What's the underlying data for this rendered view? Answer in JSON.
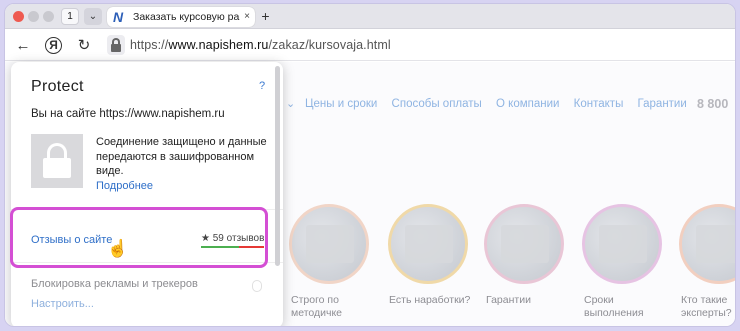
{
  "browser": {
    "tab_count": "1",
    "tab_dropdown_icon": "chevron-down-icon",
    "tab_title": "Заказать курсовую ра",
    "tab_close": "×",
    "new_tab": "+",
    "nav": {
      "back": "←",
      "yandex": "Я",
      "reload": "↻"
    },
    "url_prefix": "https://",
    "url_domain": "www.napishem.ru",
    "url_path": "/zakaz/kursovaja.html"
  },
  "site": {
    "chevron": "⌄",
    "nav_items": [
      "Цены и сроки",
      "Способы оплаты",
      "О компании",
      "Контакты",
      "Гарантии"
    ],
    "phone": "8 800",
    "features": [
      {
        "label": "Строго по методичке"
      },
      {
        "label": "Есть наработки?"
      },
      {
        "label": "Гарантии"
      },
      {
        "label": "Сроки выполнения"
      },
      {
        "label": "Кто такие эксперты?"
      }
    ]
  },
  "protect": {
    "title": "Protect",
    "help": "?",
    "site_text": "Вы на сайте https://www.napishem.ru",
    "secure_text": "Соединение защищено и данные передаются в зашифрованном виде.",
    "more_link": "Подробнее",
    "reviews_link": "Отзывы о сайте",
    "reviews_count": "★ 59 отзывов",
    "block_label": "Блокировка рекламы и трекеров",
    "setup_link": "Настроить...",
    "highlight_color": "#d44fd4"
  }
}
